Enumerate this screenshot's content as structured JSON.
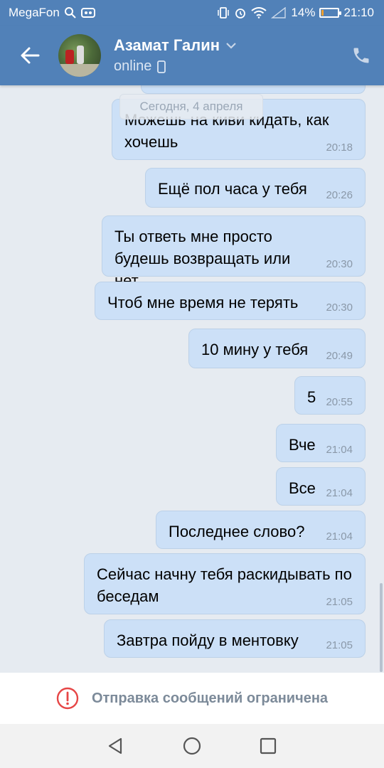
{
  "status_bar": {
    "carrier": "MegaFon",
    "battery_percent_label": "14%",
    "battery_level": 0.14,
    "time": "21:10"
  },
  "header": {
    "contact_name": "Азамат Галин",
    "status": "online"
  },
  "date_chip": "Сегодня, 4 апреля",
  "messages": [
    {
      "text": "",
      "time": ""
    },
    {
      "text": "Можешь на киви кидать, как хочешь",
      "time": "20:18"
    },
    {
      "text": "Ещё пол часа у тебя",
      "time": "20:26"
    },
    {
      "text": "Ты ответь мне просто будешь возвращать или нет",
      "time": "20:30"
    },
    {
      "text": "Чтоб мне время не терять",
      "time": "20:30"
    },
    {
      "text": "10 мину у тебя",
      "time": "20:49"
    },
    {
      "text": "5",
      "time": "20:55"
    },
    {
      "text": "Вче",
      "time": "21:04"
    },
    {
      "text": "Все",
      "time": "21:04"
    },
    {
      "text": "Последнее слово?",
      "time": "21:04"
    },
    {
      "text": "Сейчас начну тебя раскидывать по беседам",
      "time": "21:05"
    },
    {
      "text": "Завтра пойду в ментовку",
      "time": "21:05"
    }
  ],
  "restriction": {
    "text": "Отправка сообщений ограничена"
  },
  "colors": {
    "accent": "#5181b8",
    "bubble": "#cce0f7",
    "background": "#e6ebf1",
    "warning": "#e64646"
  },
  "icons": {
    "back": "arrow-left-icon",
    "phone": "phone-icon",
    "mobile": "mobile-device-icon",
    "warning": "exclamation-circle-icon"
  }
}
